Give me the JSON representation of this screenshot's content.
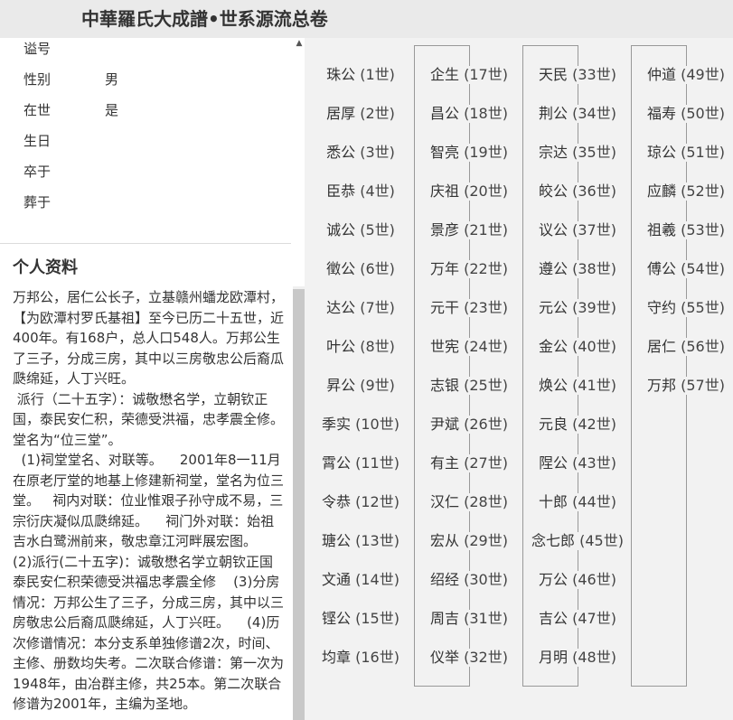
{
  "header": {
    "title": "中華羅氏大成譜•世系源流总卷"
  },
  "profile": {
    "fields": [
      {
        "label": "谥号",
        "value": ""
      },
      {
        "label": "性别",
        "value": "男"
      },
      {
        "label": "在世",
        "value": "是"
      },
      {
        "label": "生日",
        "value": ""
      },
      {
        "label": "卒于",
        "value": ""
      },
      {
        "label": "葬于",
        "value": ""
      }
    ]
  },
  "bio": {
    "title": "个人资料",
    "text": "万邦公，居仁公长子，立基赣州蟠龙欧潭村，【为欧潭村罗氏基祖】至今已历二十五世，近400年。有168户，总人口548人。万邦公生了三子，分成三房，其中以三房敬忠公后裔瓜瓞绵延，人丁兴旺。\n 派行（二十五字）：诚敬懋名学，立朝钦正国，泰民安仁积，荣德受洪福，忠孝震全修。堂名为“位三堂”。\n  (1)祠堂堂名、对联等。    2001年8一11月在原老厅堂的地基上修建新祠堂，堂名为位三堂。   祠内对联：位业惟艰子孙守成不易，三宗衍庆凝似瓜瓞绵延。    祠门外对联：始祖吉水白鹭洲前来，敬忠章江河畔展宏图。    (2)派行(二十五字)：诚敬懋名学立朝钦正国泰民安仁积荣德受洪福忠孝震全修    (3)分房情况：万邦公生了三子，分成三房，其中以三房敬忠公后裔瓜瓞绵延，人丁兴旺。    (4)历次修谱情况：本分支系单独修谱2次，时间、主修、册数均失考。二次联合修谱：第一次为1948年，由冶群主修，共25本。第二次联合修谱为2001年，主编为圣地。"
  },
  "generations": [
    {
      "name": "珠公",
      "gen": "(1世)"
    },
    {
      "name": "居厚",
      "gen": "(2世)"
    },
    {
      "name": "悉公",
      "gen": "(3世)"
    },
    {
      "name": "臣恭",
      "gen": "(4世)"
    },
    {
      "name": "诚公",
      "gen": "(5世)"
    },
    {
      "name": "徵公",
      "gen": "(6世)"
    },
    {
      "name": "达公",
      "gen": "(7世)"
    },
    {
      "name": "叶公",
      "gen": "(8世)"
    },
    {
      "name": "昇公",
      "gen": "(9世)"
    },
    {
      "name": "季实",
      "gen": "(10世)"
    },
    {
      "name": "霄公",
      "gen": "(11世)"
    },
    {
      "name": "令恭",
      "gen": "(12世)"
    },
    {
      "name": "瑭公",
      "gen": "(13世)"
    },
    {
      "name": "文通",
      "gen": "(14世)"
    },
    {
      "name": "铿公",
      "gen": "(15世)"
    },
    {
      "name": "均章",
      "gen": "(16世)"
    },
    {
      "name": "企生",
      "gen": "(17世)"
    },
    {
      "name": "昌公",
      "gen": "(18世)"
    },
    {
      "name": "智亮",
      "gen": "(19世)"
    },
    {
      "name": "庆祖",
      "gen": "(20世)"
    },
    {
      "name": "景彦",
      "gen": "(21世)"
    },
    {
      "name": "万年",
      "gen": "(22世)"
    },
    {
      "name": "元干",
      "gen": "(23世)"
    },
    {
      "name": "世宪",
      "gen": "(24世)"
    },
    {
      "name": "志银",
      "gen": "(25世)"
    },
    {
      "name": "尹斌",
      "gen": "(26世)"
    },
    {
      "name": "有主",
      "gen": "(27世)"
    },
    {
      "name": "汉仁",
      "gen": "(28世)"
    },
    {
      "name": "宏从",
      "gen": "(29世)"
    },
    {
      "name": "绍经",
      "gen": "(30世)"
    },
    {
      "name": "周吉",
      "gen": "(31世)"
    },
    {
      "name": "仪举",
      "gen": "(32世)"
    },
    {
      "name": "天民",
      "gen": "(33世)"
    },
    {
      "name": "荆公",
      "gen": "(34世)"
    },
    {
      "name": "宗达",
      "gen": "(35世)"
    },
    {
      "name": "皎公",
      "gen": "(36世)"
    },
    {
      "name": "议公",
      "gen": "(37世)"
    },
    {
      "name": "遵公",
      "gen": "(38世)"
    },
    {
      "name": "元公",
      "gen": "(39世)"
    },
    {
      "name": "金公",
      "gen": "(40世)"
    },
    {
      "name": "焕公",
      "gen": "(41世)"
    },
    {
      "name": "元良",
      "gen": "(42世)"
    },
    {
      "name": "陧公",
      "gen": "(43世)"
    },
    {
      "name": "十郎",
      "gen": "(44世)"
    },
    {
      "name": "念七郎",
      "gen": "(45世)"
    },
    {
      "name": "万公",
      "gen": "(46世)"
    },
    {
      "name": "吉公",
      "gen": "(47世)"
    },
    {
      "name": "月明",
      "gen": "(48世)"
    },
    {
      "name": "仲道",
      "gen": "(49世)"
    },
    {
      "name": "福寿",
      "gen": "(50世)"
    },
    {
      "name": "琼公",
      "gen": "(51世)"
    },
    {
      "name": "应麟",
      "gen": "(52世)"
    },
    {
      "name": "祖羲",
      "gen": "(53世)"
    },
    {
      "name": "傅公",
      "gen": "(54世)"
    },
    {
      "name": "守约",
      "gen": "(55世)"
    },
    {
      "name": "居仁",
      "gen": "(56世)"
    },
    {
      "name": "万邦",
      "gen": "(57世)"
    }
  ]
}
